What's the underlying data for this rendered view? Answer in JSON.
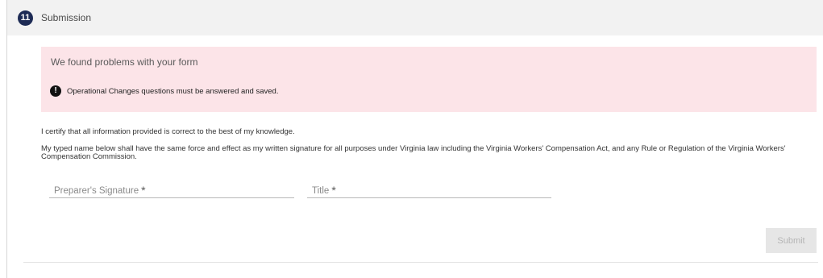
{
  "step": {
    "number": "11",
    "title": "Submission"
  },
  "alert": {
    "title": "We found problems with your form",
    "icon": "exclamation-circle-icon",
    "message": "Operational Changes questions must be answered and saved.",
    "background": "#fce4e8"
  },
  "certify_text": "I certify that all information provided is correct to the best of my knowledge.",
  "legal_text": "My typed name below shall have the same force and effect as my written signature for all purposes under Virginia law including the Virginia Workers' Compensation Act, and any Rule or Regulation of the Virginia Workers' Compensation Commission.",
  "fields": {
    "signature": {
      "label": "Preparer's Signature",
      "required_mark": "*",
      "value": ""
    },
    "title": {
      "label": "Title",
      "required_mark": "*",
      "value": ""
    }
  },
  "submit": {
    "label": "Submit",
    "disabled": true
  },
  "colors": {
    "step_badge": "#1d2b55",
    "header_bg": "#f2f2f2"
  }
}
